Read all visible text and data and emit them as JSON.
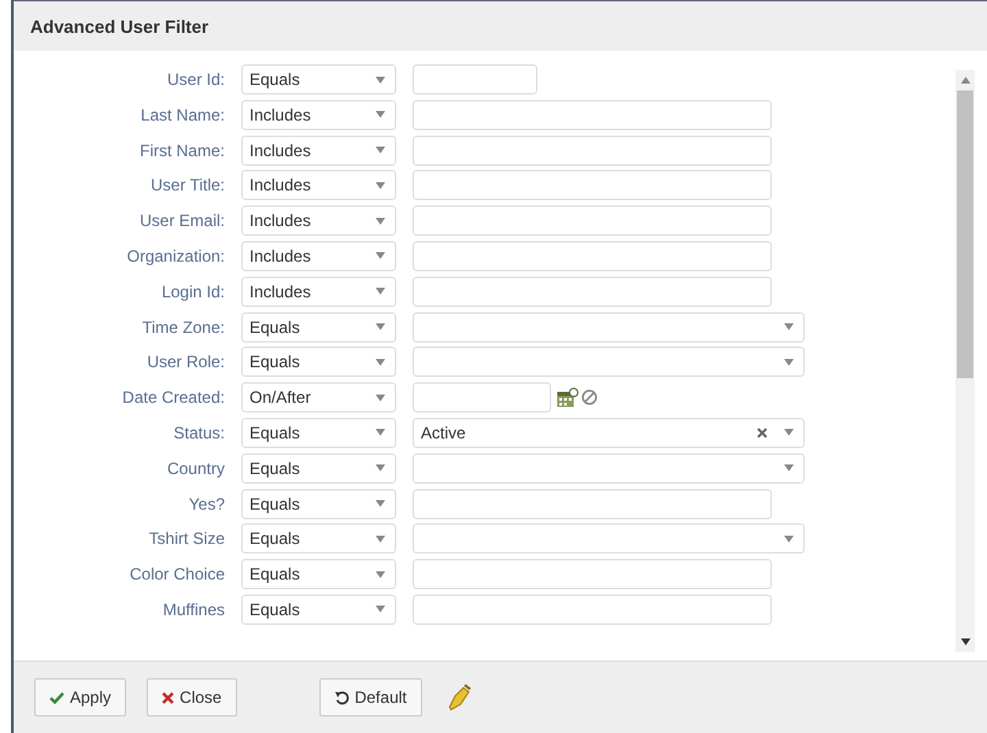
{
  "window": {
    "title": "Advanced User Filter"
  },
  "rows": [
    {
      "label": "User Id:",
      "operator": "Equals",
      "kind": "short"
    },
    {
      "label": "Last Name:",
      "operator": "Includes",
      "kind": "text"
    },
    {
      "label": "First Name:",
      "operator": "Includes",
      "kind": "text"
    },
    {
      "label": "User Title:",
      "operator": "Includes",
      "kind": "text"
    },
    {
      "label": "User Email:",
      "operator": "Includes",
      "kind": "text"
    },
    {
      "label": "Organization:",
      "operator": "Includes",
      "kind": "text"
    },
    {
      "label": "Login Id:",
      "operator": "Includes",
      "kind": "text"
    },
    {
      "label": "Time Zone:",
      "operator": "Equals",
      "kind": "select"
    },
    {
      "label": "User Role:",
      "operator": "Equals",
      "kind": "select"
    },
    {
      "label": "Date Created:",
      "operator": "On/After",
      "kind": "date"
    },
    {
      "label": "Status:",
      "operator": "Equals",
      "kind": "select",
      "value": "Active"
    },
    {
      "label": "Country",
      "operator": "Equals",
      "kind": "select"
    },
    {
      "label": "Yes?",
      "operator": "Equals",
      "kind": "text"
    },
    {
      "label": "Tshirt Size",
      "operator": "Equals",
      "kind": "select"
    },
    {
      "label": "Color Choice",
      "operator": "Equals",
      "kind": "text"
    },
    {
      "label": "Muffines",
      "operator": "Equals",
      "kind": "text"
    }
  ],
  "buttons": [
    {
      "label": "Apply",
      "kind": "apply"
    },
    {
      "label": "Close",
      "kind": "close"
    },
    {
      "label": "Default",
      "kind": "default"
    }
  ]
}
